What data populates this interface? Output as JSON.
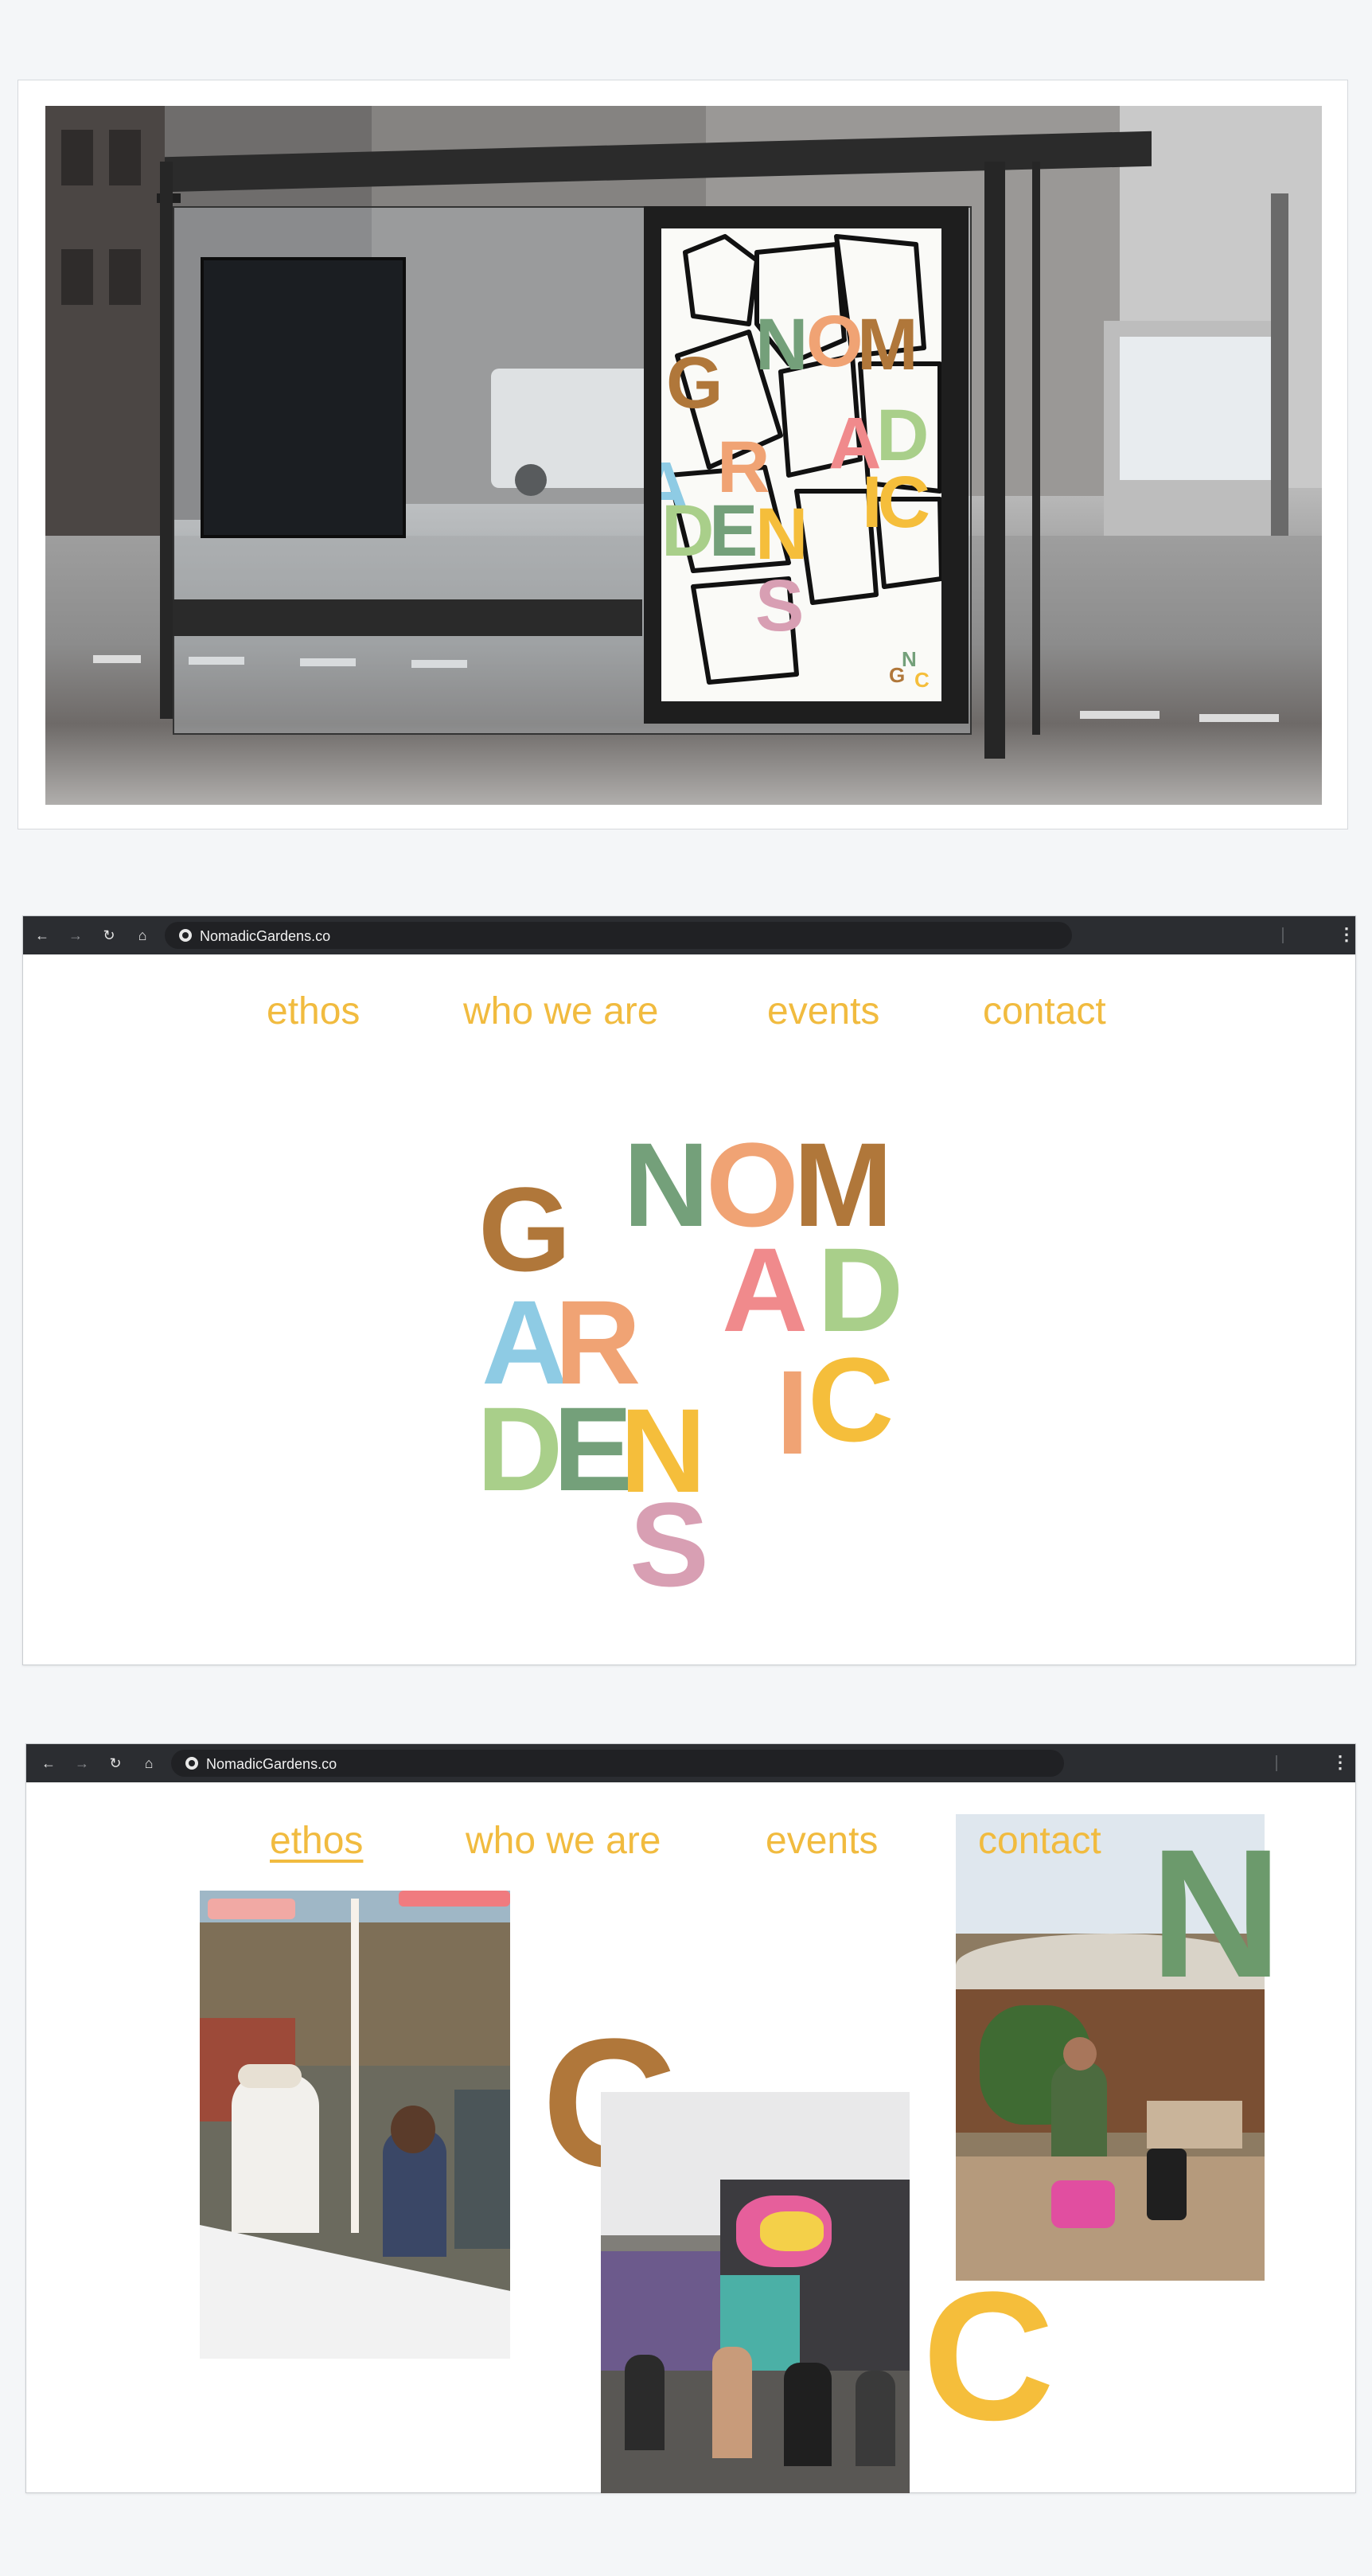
{
  "colors": {
    "nav_text": "#f1bb3f",
    "brown": "#b0773a",
    "green": "#74a07a",
    "orange": "#f0a374",
    "coral": "#f08a8c",
    "lightgreen": "#a9cf8a",
    "blue": "#8ecbe4",
    "pink": "#d89fb3",
    "yellow": "#f5be3b",
    "dark_green": "#6c9a6c",
    "browser_bar": "#2b2d31"
  },
  "mockup": {
    "poster_logo": {
      "word1": [
        "N",
        "O",
        "M",
        "A",
        "D",
        "I",
        "C"
      ],
      "word2": [
        "G",
        "A",
        "R",
        "D",
        "E",
        "N",
        "S"
      ],
      "monogram_top": "N",
      "monogram_bottom_left": "G",
      "monogram_bottom_right": "C"
    }
  },
  "browser1": {
    "url": "NomadicGardens.co",
    "nav": [
      "ethos",
      "who we are",
      "events",
      "contact"
    ],
    "logo": {
      "NOM": [
        "N",
        "O",
        "M"
      ],
      "G": "G",
      "AD": [
        "A",
        "D"
      ],
      "AR": [
        "A",
        "R"
      ],
      "IC": [
        "I",
        "C"
      ],
      "DEN": [
        "D",
        "E",
        "N"
      ],
      "S": "S"
    }
  },
  "browser2": {
    "url": "NomadicGardens.co",
    "nav": [
      "ethos",
      "who we are",
      "events",
      "contact"
    ],
    "active_nav": "ethos",
    "big_letters": {
      "N": "N",
      "G": "G",
      "C": "C"
    }
  }
}
